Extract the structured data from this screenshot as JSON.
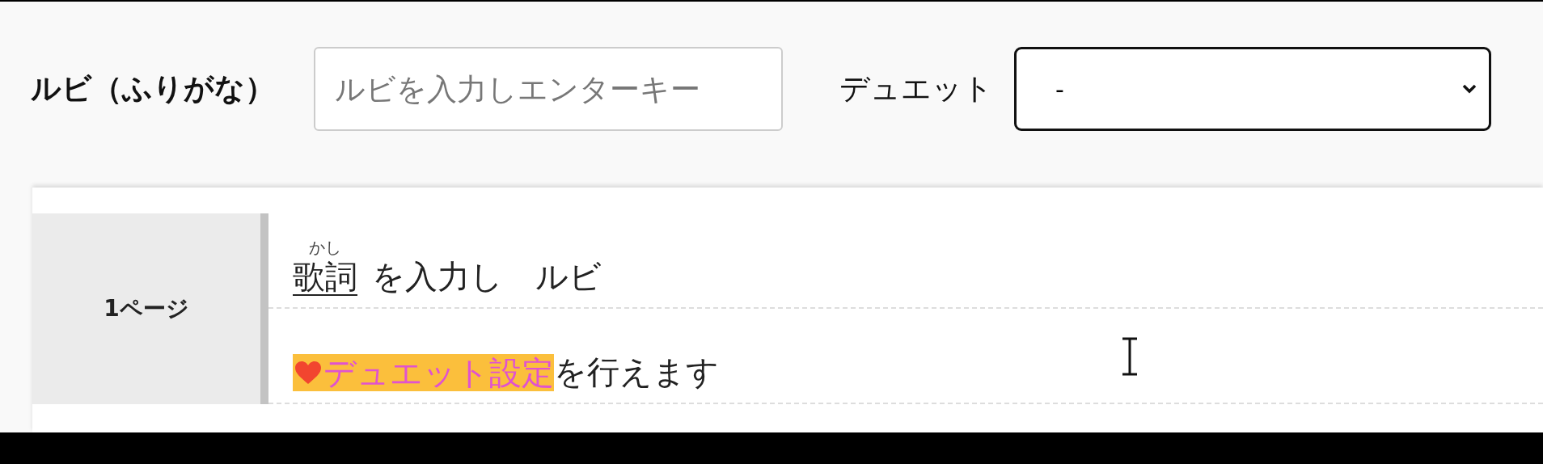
{
  "ruby_field": {
    "label": "ルビ（ふりがな）",
    "placeholder": "ルビを入力しエンターキー"
  },
  "duet": {
    "label": "デュエット",
    "value": "-"
  },
  "pages": [
    {
      "label": "1ページ",
      "lines": [
        {
          "segments": [
            {
              "kind": "ruby",
              "text": "歌詞",
              "ruby": "かし"
            },
            {
              "kind": "plain",
              "text": "を入力し"
            },
            {
              "kind": "plain",
              "text": "ルビ"
            }
          ]
        },
        {
          "segments": [
            {
              "kind": "duet",
              "text": "デュエット設定"
            },
            {
              "kind": "plain",
              "text": "を行えます"
            }
          ]
        }
      ]
    }
  ]
}
